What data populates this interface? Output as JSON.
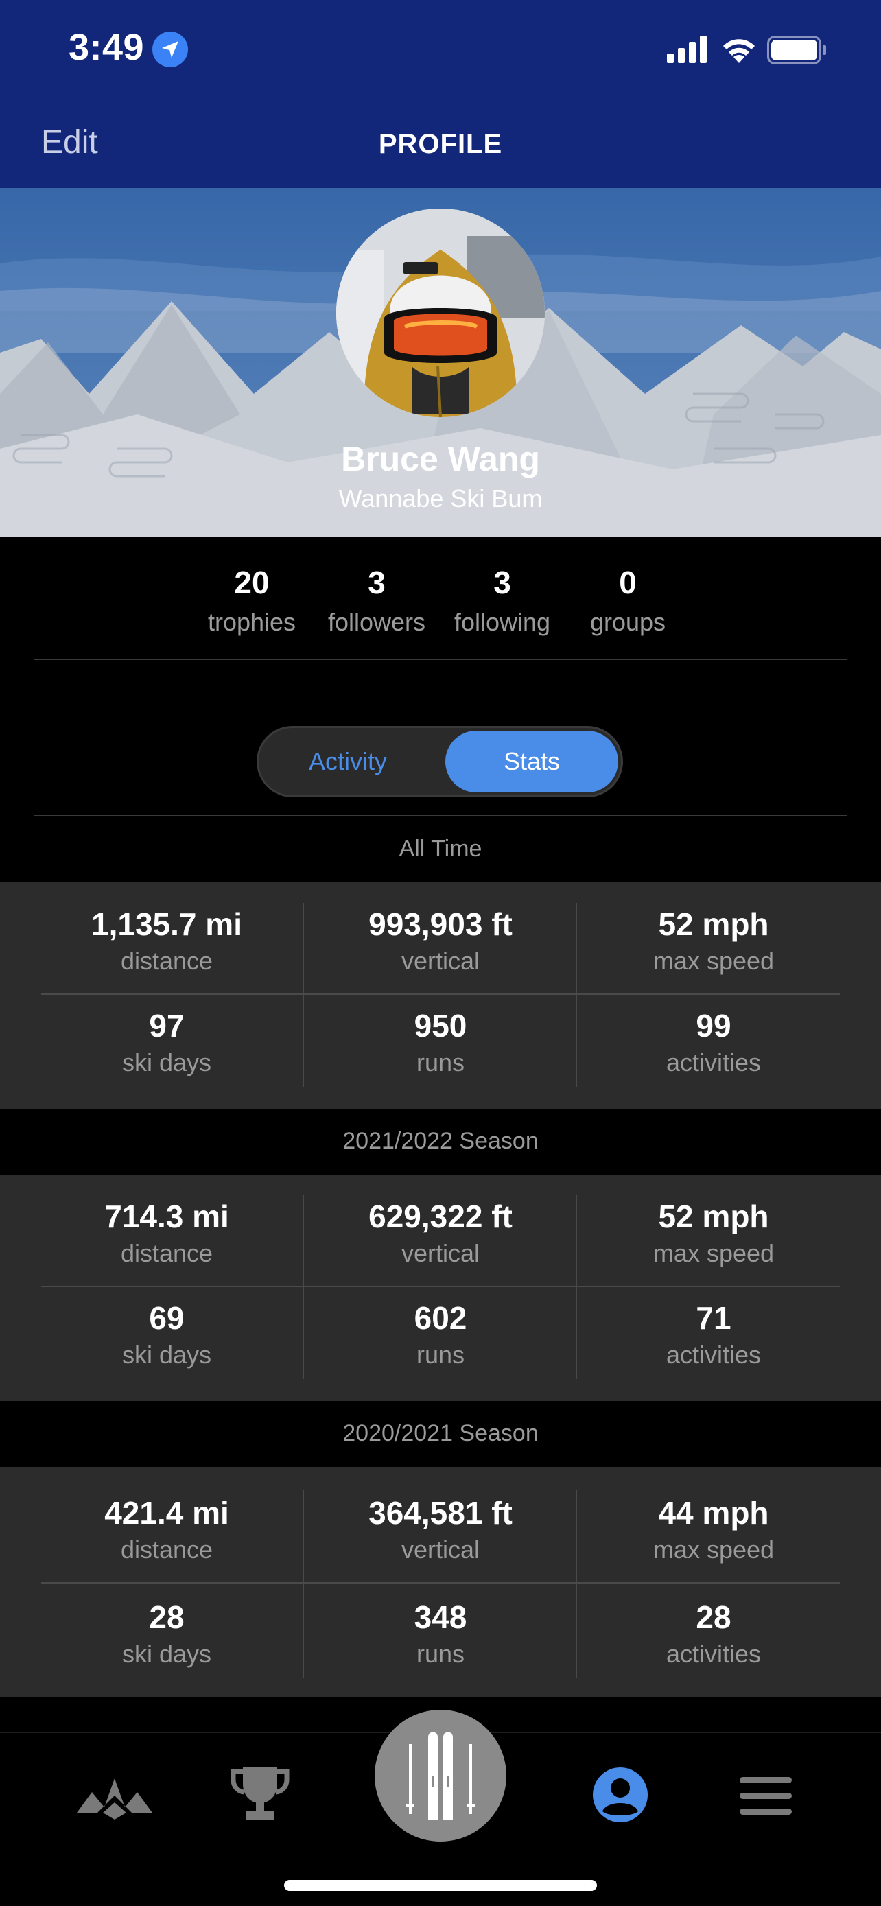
{
  "status_bar": {
    "time": "3:49"
  },
  "nav": {
    "edit_label": "Edit",
    "title": "PROFILE"
  },
  "profile": {
    "name": "Bruce Wang",
    "tagline": "Wannabe Ski Bum"
  },
  "counts": [
    {
      "value": "20",
      "label": "trophies"
    },
    {
      "value": "3",
      "label": "followers"
    },
    {
      "value": "3",
      "label": "following"
    },
    {
      "value": "0",
      "label": "groups"
    }
  ],
  "toggle": {
    "activity_label": "Activity",
    "stats_label": "Stats",
    "selected": "Stats"
  },
  "sections": [
    {
      "title": "All Time",
      "stats": [
        {
          "value": "1,135.7 mi",
          "label": "distance"
        },
        {
          "value": "993,903 ft",
          "label": "vertical"
        },
        {
          "value": "52 mph",
          "label": "max speed"
        },
        {
          "value": "97",
          "label": "ski days"
        },
        {
          "value": "950",
          "label": "runs"
        },
        {
          "value": "99",
          "label": "activities"
        }
      ]
    },
    {
      "title": "2021/2022 Season",
      "stats": [
        {
          "value": "714.3 mi",
          "label": "distance"
        },
        {
          "value": "629,322 ft",
          "label": "vertical"
        },
        {
          "value": "52 mph",
          "label": "max speed"
        },
        {
          "value": "69",
          "label": "ski days"
        },
        {
          "value": "602",
          "label": "runs"
        },
        {
          "value": "71",
          "label": "activities"
        }
      ]
    },
    {
      "title": "2020/2021 Season",
      "stats": [
        {
          "value": "421.4 mi",
          "label": "distance"
        },
        {
          "value": "364,581 ft",
          "label": "vertical"
        },
        {
          "value": "44 mph",
          "label": "max speed"
        },
        {
          "value": "28",
          "label": "ski days"
        },
        {
          "value": "348",
          "label": "runs"
        },
        {
          "value": "28",
          "label": "activities"
        }
      ]
    }
  ],
  "tabbar": {
    "items": [
      "mountains-icon",
      "trophy-icon",
      "skis-icon",
      "profile-icon",
      "menu-icon"
    ],
    "active": "profile-icon"
  },
  "colors": {
    "nav_bg": "#13277a",
    "accent": "#4a8de8",
    "block_bg": "#2c2c2c"
  }
}
